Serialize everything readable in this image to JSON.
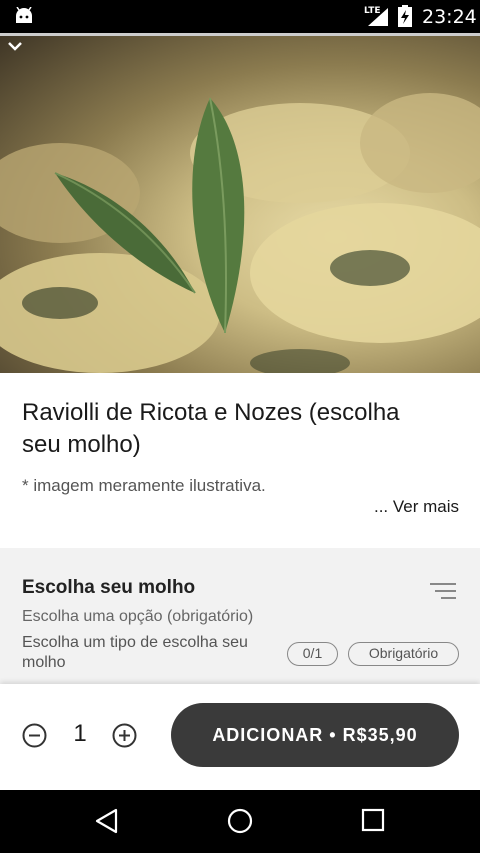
{
  "status_bar": {
    "network": "LTE",
    "time": "23:24",
    "icons": [
      "android-notification-icon",
      "lte-signal-icon",
      "battery-charging-icon"
    ]
  },
  "product": {
    "title": "Raviolli de Ricota e Nozes (escolha seu molho)",
    "image_note": "* imagem meramente ilustrativa.",
    "see_more": "... Ver mais"
  },
  "option_group": {
    "title": "Escolha seu molho",
    "subtitle": "Escolha uma opção (obrigatório)",
    "description": "Escolha um tipo de escolha seu molho",
    "count": "0/1",
    "required": "Obrigatório"
  },
  "footer": {
    "quantity": "1",
    "add_button": "ADICIONAR • R$35,90"
  },
  "colors": {
    "button_bg": "#3a3a3a",
    "section_bg": "#f2f2f2"
  }
}
